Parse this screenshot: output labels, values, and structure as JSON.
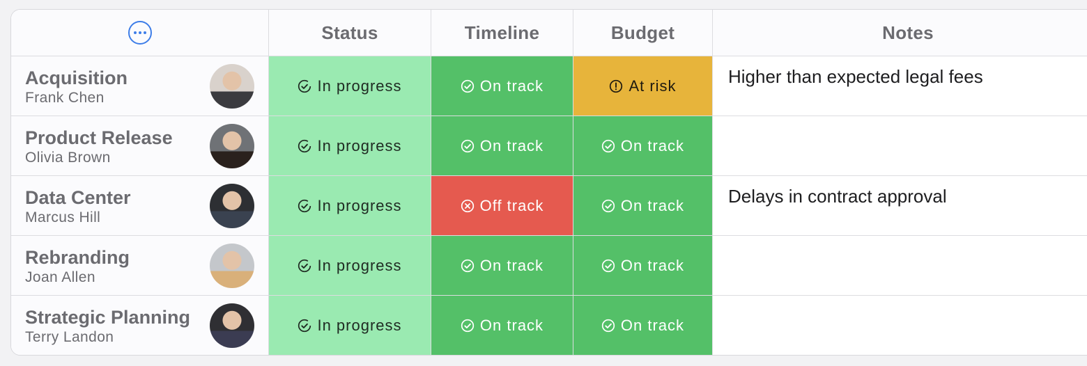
{
  "header": {
    "status": "Status",
    "timeline": "Timeline",
    "budget": "Budget",
    "notes": "Notes"
  },
  "rows": [
    {
      "project": "Acquisition",
      "owner": "Frank Chen",
      "status": "In progress",
      "timeline": "On track",
      "budget": "At risk",
      "note": "Higher than expected legal fees",
      "avatar_colors": [
        "#d9d2cc",
        "#3b3b3f"
      ]
    },
    {
      "project": "Product Release",
      "owner": "Olivia Brown",
      "status": "In progress",
      "timeline": "On track",
      "budget": "On track",
      "note": "",
      "avatar_colors": [
        "#6f7276",
        "#2a211d"
      ]
    },
    {
      "project": "Data Center",
      "owner": "Marcus Hill",
      "status": "In progress",
      "timeline": "Off track",
      "budget": "On track",
      "note": "Delays in contract approval",
      "avatar_colors": [
        "#2d2f33",
        "#3a4250"
      ]
    },
    {
      "project": "Rebranding",
      "owner": "Joan Allen",
      "status": "In progress",
      "timeline": "On track",
      "budget": "On track",
      "note": "",
      "avatar_colors": [
        "#c4c7cb",
        "#d9b07a"
      ]
    },
    {
      "project": "Strategic Planning",
      "owner": "Terry Landon",
      "status": "In progress",
      "timeline": "On track",
      "budget": "On track",
      "note": "",
      "avatar_colors": [
        "#2f2f33",
        "#3b3c52"
      ]
    }
  ],
  "colors": {
    "accent": "#3d7de8",
    "in_progress": "#9aeab1",
    "on_track": "#54c068",
    "off_track": "#e55a4f",
    "at_risk": "#e7b43b"
  },
  "icons": {
    "more": "more-options-icon",
    "in_progress": "clock-check-icon",
    "on_track": "check-circle-icon",
    "off_track": "x-circle-icon",
    "at_risk": "exclamation-circle-icon"
  }
}
